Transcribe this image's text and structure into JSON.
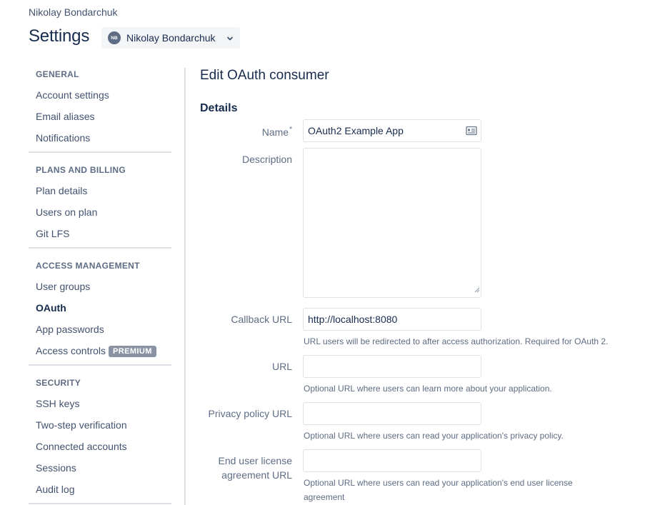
{
  "header": {
    "breadcrumb": "Nikolay Bondarchuk",
    "title": "Settings",
    "account": {
      "initials": "NB",
      "name": "Nikolay Bondarchuk"
    }
  },
  "sidebar": {
    "sections": [
      {
        "heading": "GENERAL",
        "items": [
          "Account settings",
          "Email aliases",
          "Notifications"
        ]
      },
      {
        "heading": "PLANS AND BILLING",
        "items": [
          "Plan details",
          "Users on plan",
          "Git LFS"
        ]
      },
      {
        "heading": "ACCESS MANAGEMENT",
        "items": [
          "User groups",
          "OAuth",
          "App passwords",
          "Access controls"
        ]
      },
      {
        "heading": "SECURITY",
        "items": [
          "SSH keys",
          "Two-step verification",
          "Connected accounts",
          "Sessions",
          "Audit log"
        ]
      }
    ],
    "active_item": "OAuth",
    "premium_badge": "PREMIUM"
  },
  "main": {
    "title": "Edit OAuth consumer",
    "section_title": "Details",
    "fields": {
      "name": {
        "label": "Name",
        "required_marker": "*",
        "value": "OAuth2 Example App"
      },
      "description": {
        "label": "Description",
        "value": ""
      },
      "callback_url": {
        "label": "Callback URL",
        "value": "http://localhost:8080",
        "hint": "URL users will be redirected to after access authorization. Required for OAuth 2."
      },
      "url": {
        "label": "URL",
        "value": "",
        "hint": "Optional URL where users can learn more about your application."
      },
      "privacy_policy_url": {
        "label": "Privacy policy URL",
        "value": "",
        "hint": "Optional URL where users can read your application's privacy policy."
      },
      "eula_url": {
        "label_line1": "End user license",
        "label_line2": "agreement URL",
        "value": "",
        "hint_line1": "Optional URL where users can read your application's end user license",
        "hint_line2": "agreement"
      }
    }
  },
  "colors": {
    "text": "#172b4d",
    "muted": "#5e6c84",
    "border": "#dfe1e6",
    "badge": "#8993a4"
  }
}
